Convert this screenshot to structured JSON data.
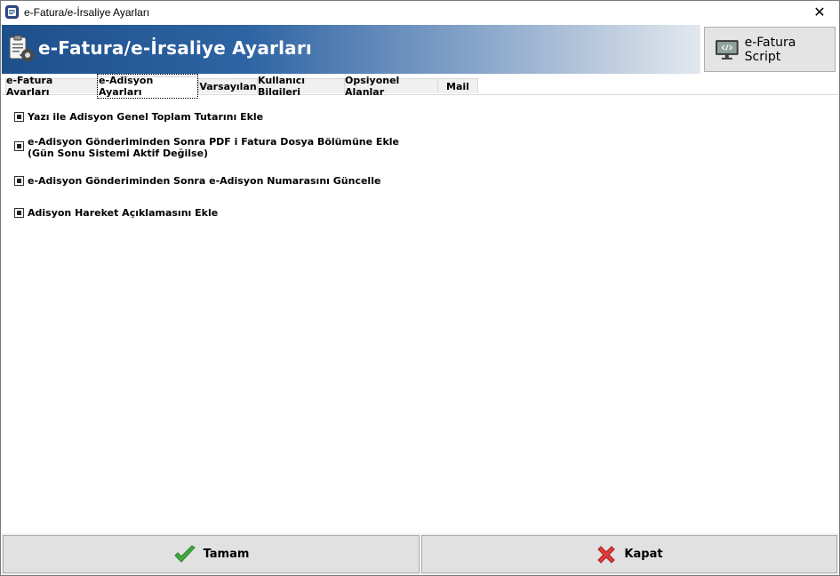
{
  "window": {
    "title": "e-Fatura/e-İrsaliye Ayarları",
    "close_glyph": "✕",
    "app_icon": "form-app-icon"
  },
  "header": {
    "title": "e-Fatura/e-İrsaliye Ayarları",
    "icon": "clipboard-gear-icon",
    "script_button_label": "e-Fatura Script",
    "script_button_icon": "monitor-code-icon",
    "gradient_start": "#1d4f8b",
    "gradient_end": "#e3e8ee"
  },
  "tabs": [
    {
      "label": "e-Fatura Ayarları",
      "active": false
    },
    {
      "label": "e-Adisyon Ayarları",
      "active": true
    },
    {
      "label": "Varsayılan",
      "active": false
    },
    {
      "label": "Kullanıcı Bilgileri",
      "active": false
    },
    {
      "label": "Opsiyonel Alanlar",
      "active": false
    },
    {
      "label": "Mail",
      "active": false
    }
  ],
  "options": [
    {
      "label": "Yazı ile Adisyon Genel Toplam Tutarını Ekle",
      "state": "indeterminate"
    },
    {
      "label": "e-Adisyon Gönderiminden Sonra PDF i Fatura Dosya Bölümüne Ekle",
      "label_line2": "(Gün Sonu Sistemi Aktif Değilse)",
      "state": "indeterminate"
    },
    {
      "label": "e-Adisyon Gönderiminden Sonra e-Adisyon Numarasını Güncelle",
      "state": "indeterminate"
    },
    {
      "label": "Adisyon Hareket Açıklamasını Ekle",
      "state": "indeterminate"
    }
  ],
  "footer": {
    "ok_label": "Tamam",
    "ok_icon": "green-check-icon",
    "cancel_label": "Kapat",
    "cancel_icon": "red-x-icon"
  }
}
